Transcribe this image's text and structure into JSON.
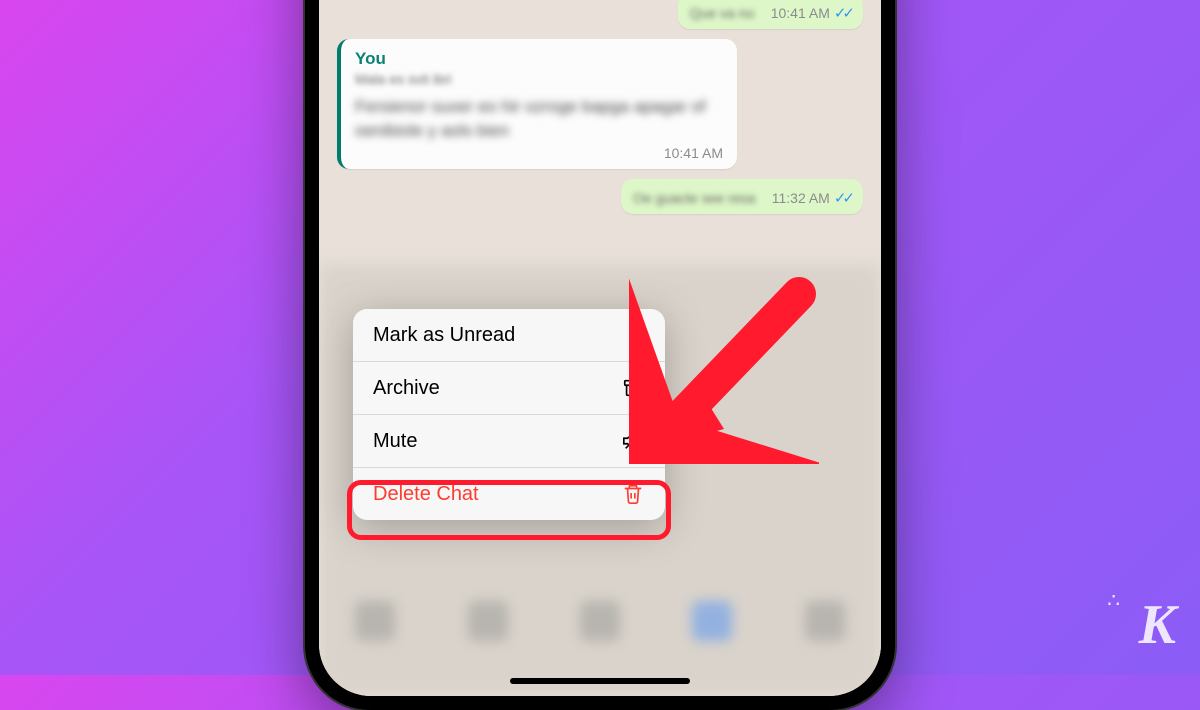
{
  "chat": {
    "bubble1_time": "10:41 AM",
    "quote_label": "You",
    "bubble2_time": "10:41 AM",
    "bubble3_time": "11:32 AM"
  },
  "menu": {
    "mark_unread": "Mark as Unread",
    "archive": "Archive",
    "mute": "Mute",
    "delete": "Delete Chat"
  },
  "watermark": "K"
}
